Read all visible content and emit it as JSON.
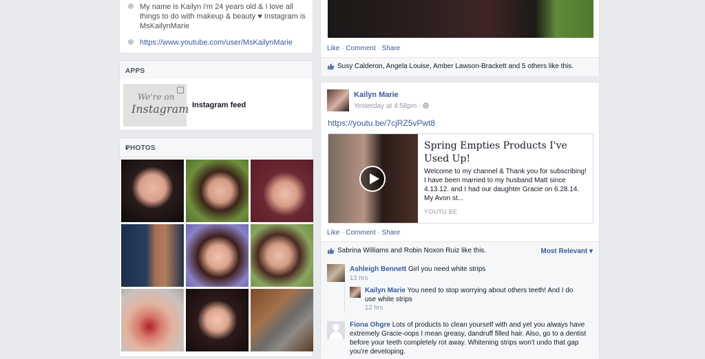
{
  "about": {
    "bio": "My name is Kailyn i'm 24 years old & I love all things to do with makeup & beauty ♥ Instagram is MsKailynMarie",
    "website": "https://www.youtube.com/user/MsKailynMarie"
  },
  "apps": {
    "heading": "APPS",
    "thumb_line1": "We're on",
    "thumb_line2": "Instagram",
    "item_label": "Instagram feed"
  },
  "photos": {
    "heading": "PHOTOS",
    "chevron": "›"
  },
  "post1": {
    "actions": {
      "like": "Like",
      "comment": "Comment",
      "share": "Share",
      "sep": "·"
    },
    "likes": "Susy Calderon, Angela Louise, Amber Lawson-Brackett and 5 others like this."
  },
  "post2": {
    "author": "Kailyn Marie",
    "time": "Yesterday at 4:58pm · ",
    "link": "https://youtu.be/7cjRZ5vPwt8",
    "embed": {
      "title": "Spring Empties Products I've Used Up!",
      "description": "Welcome to my channel & Thank you for subscribing! I have been married to my husband Matt since 4.13.12. and I had our daughter Gracie on 6.28.14. My Avon st...",
      "source": "YOUTU.BE"
    },
    "actions": {
      "like": "Like",
      "comment": "Comment",
      "share": "Share",
      "sep": "·"
    },
    "likes": "Sabrina Williams and Robin Noxon Ruiz like this.",
    "sort": "Most Relevant ▾",
    "comments": [
      {
        "name": "Ashleigh Bennett",
        "text": "Girl you need white strips",
        "time": "13 hrs"
      },
      {
        "name": "Kailyn Marie",
        "text": "You need to stop worrying about others teeth! And I do use white strips",
        "time": "12 hrs"
      },
      {
        "name": "Fiona Ohgre",
        "text": "Lots of products to clean yourself with and yet you always have extremely Gracie-oops I mean greasy, dandruff filled hair. Also, go to a dentist before your teeth completely rot away. Whitening strips won't undo that gap you're developing."
      }
    ]
  }
}
